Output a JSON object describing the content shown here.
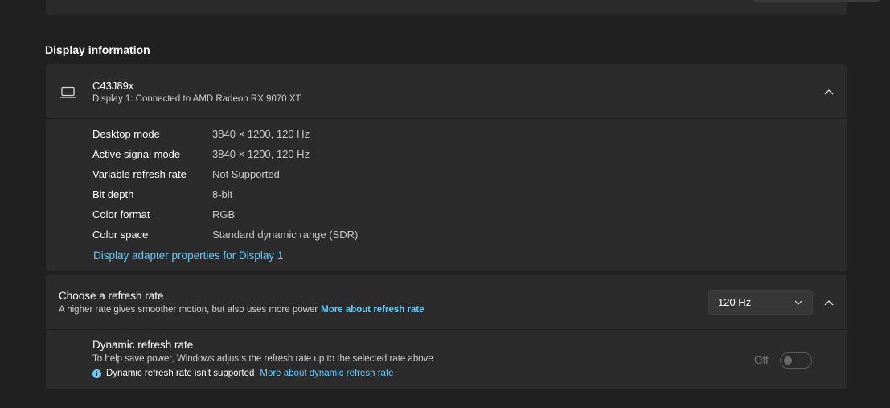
{
  "section_title": "Display information",
  "display": {
    "name": "C43J89x",
    "subtitle": "Display 1: Connected to AMD Radeon RX 9070 XT",
    "icon": "monitor-icon",
    "details": [
      {
        "label": "Desktop mode",
        "value": "3840 × 1200, 120 Hz"
      },
      {
        "label": "Active signal mode",
        "value": "3840 × 1200, 120 Hz"
      },
      {
        "label": "Variable refresh rate",
        "value": "Not Supported"
      },
      {
        "label": "Bit depth",
        "value": "8-bit"
      },
      {
        "label": "Color format",
        "value": "RGB"
      },
      {
        "label": "Color space",
        "value": "Standard dynamic range (SDR)"
      }
    ],
    "adapter_link": "Display adapter properties for Display 1"
  },
  "refresh": {
    "title": "Choose a refresh rate",
    "subtitle": "A higher rate gives smoother motion, but also uses more power",
    "link": "More about refresh rate",
    "selected": "120 Hz"
  },
  "dynamic": {
    "title": "Dynamic refresh rate",
    "subtitle": "To help save power, Windows adjusts the refresh rate up to the selected rate above",
    "note": "Dynamic refresh rate isn't supported",
    "link": "More about dynamic refresh rate",
    "toggle_label": "Off",
    "toggle_on": false
  },
  "colors": {
    "background": "#202020",
    "card": "#2b2b2b",
    "accent": "#60cdff"
  }
}
